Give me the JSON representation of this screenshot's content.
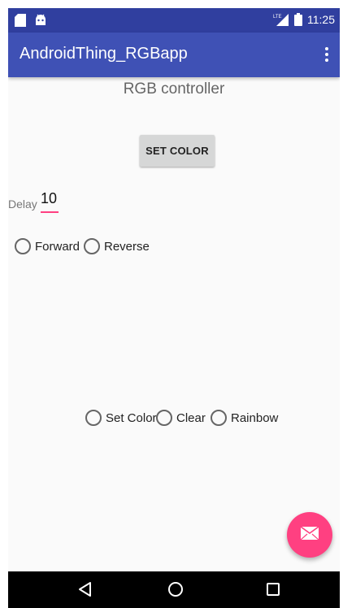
{
  "status_bar": {
    "time": "11:25",
    "left_icons": [
      "sd-card-icon",
      "android-icon"
    ],
    "right_icons": [
      "lte-signal-icon",
      "battery-icon"
    ]
  },
  "app_bar": {
    "title": "AndroidThing_RGBapp",
    "menu_icon": "overflow-menu-icon"
  },
  "main": {
    "heading": "RGB controller",
    "set_color_button": "SET COLOR",
    "delay": {
      "label": "Delay",
      "value": "10"
    },
    "direction_options": [
      {
        "label": "Forward",
        "checked": false
      },
      {
        "label": "Reverse",
        "checked": false
      }
    ],
    "mode_options": [
      {
        "label": "Set Color",
        "checked": false
      },
      {
        "label": "Clear",
        "checked": false
      },
      {
        "label": "Rainbow",
        "checked": false
      }
    ]
  },
  "fab": {
    "icon": "mail-icon"
  },
  "nav_bar": {
    "buttons": [
      "back-icon",
      "home-icon",
      "recents-icon"
    ]
  },
  "colors": {
    "status_bar": "#303f9f",
    "app_bar": "#3f51b5",
    "accent": "#ff4081",
    "background": "#fafafa"
  }
}
